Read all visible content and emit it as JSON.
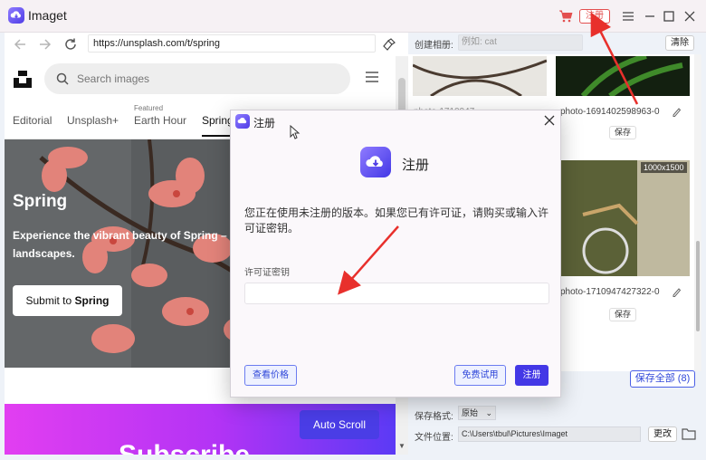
{
  "app": {
    "title": "Imaget",
    "register_label": "注册"
  },
  "browser": {
    "url": "https://unsplash.com/t/spring",
    "search_placeholder": "Search images",
    "topics": [
      {
        "label": "Editorial"
      },
      {
        "label": "Unsplash+"
      },
      {
        "label": "Earth Hour",
        "tag": "Featured"
      },
      {
        "label": "Spring"
      }
    ],
    "hero": {
      "title": "Spring",
      "description": "Experience the vibrant beauty of Spring – fro",
      "description2": "landscapes.",
      "submit_prefix": "Submit to ",
      "submit_bold": "Spring"
    },
    "promo": {
      "auto_scroll": "Auto Scroll",
      "big_text": "Subscribe"
    }
  },
  "panel": {
    "album_label": "创建相册:",
    "album_placeholder": "例如: cat",
    "clear_label": "清除",
    "items": [
      {
        "caption": "photo-1691402598963-0",
        "save": "保存"
      },
      {
        "caption": "photo-1710947427322-0",
        "save": "保存",
        "dimensions": "1000x1500"
      }
    ],
    "hidden_caption": "photo-1710947...",
    "save_all_label": "保存全部 (8)",
    "format_label": "保存格式:",
    "format_value": "原始",
    "location_label": "文件位置:",
    "location_value": "C:\\Users\\tbul\\Pictures\\Imaget",
    "change_label": "更改"
  },
  "dialog": {
    "title": "注册",
    "heading": "注册",
    "message": "您正在使用未注册的版本。如果您已有许可证，请购买或输入许可证密钥。",
    "key_label": "许可证密钥",
    "key_value": "",
    "price_label": "查看价格",
    "trial_label": "免费试用",
    "register_label": "注册"
  },
  "colors": {
    "accent": "#4338e6",
    "register_red": "#e34f4f",
    "arrow_red": "#e8302c"
  }
}
